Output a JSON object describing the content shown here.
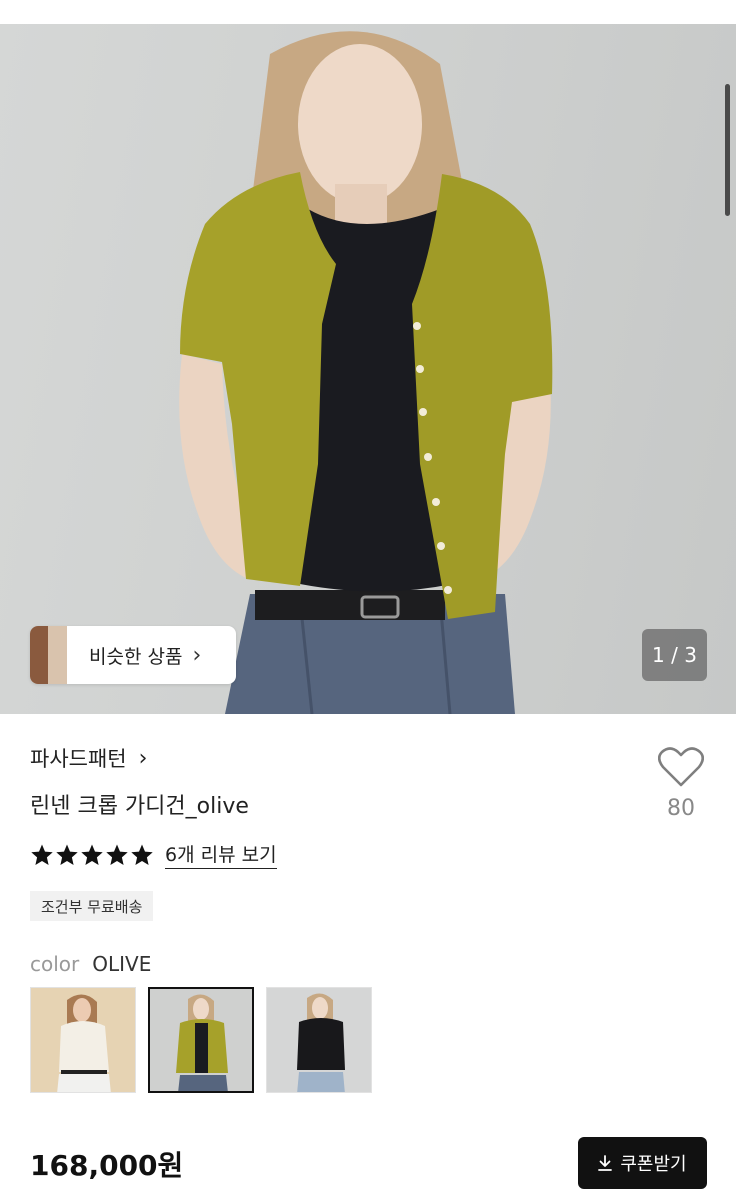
{
  "gallery": {
    "similar_label": "비슷한 상품",
    "similar_chevron": "chevron-right-icon",
    "pager": "1 / 3"
  },
  "product": {
    "brand": "파사드패턴",
    "brand_chevron": "chevron-right-icon",
    "title": "린넨 크롭 가디건_olive",
    "like_icon": "heart-outline-icon",
    "like_count": "80",
    "rating_stars": 5,
    "review_link": "6개 리뷰 보기",
    "shipping_badge": "조건부 무료배송",
    "color_key": "color",
    "color_value": "OLIVE",
    "color_options": [
      "white",
      "olive",
      "black"
    ],
    "selected_color_index": 1,
    "price": "168,000원",
    "coupon_button": "쿠폰받기",
    "coupon_icon": "download-icon"
  },
  "colors": {
    "accent": "#111111",
    "olive": "#a6a12a",
    "star": "#111111",
    "like_count": "#888888"
  }
}
